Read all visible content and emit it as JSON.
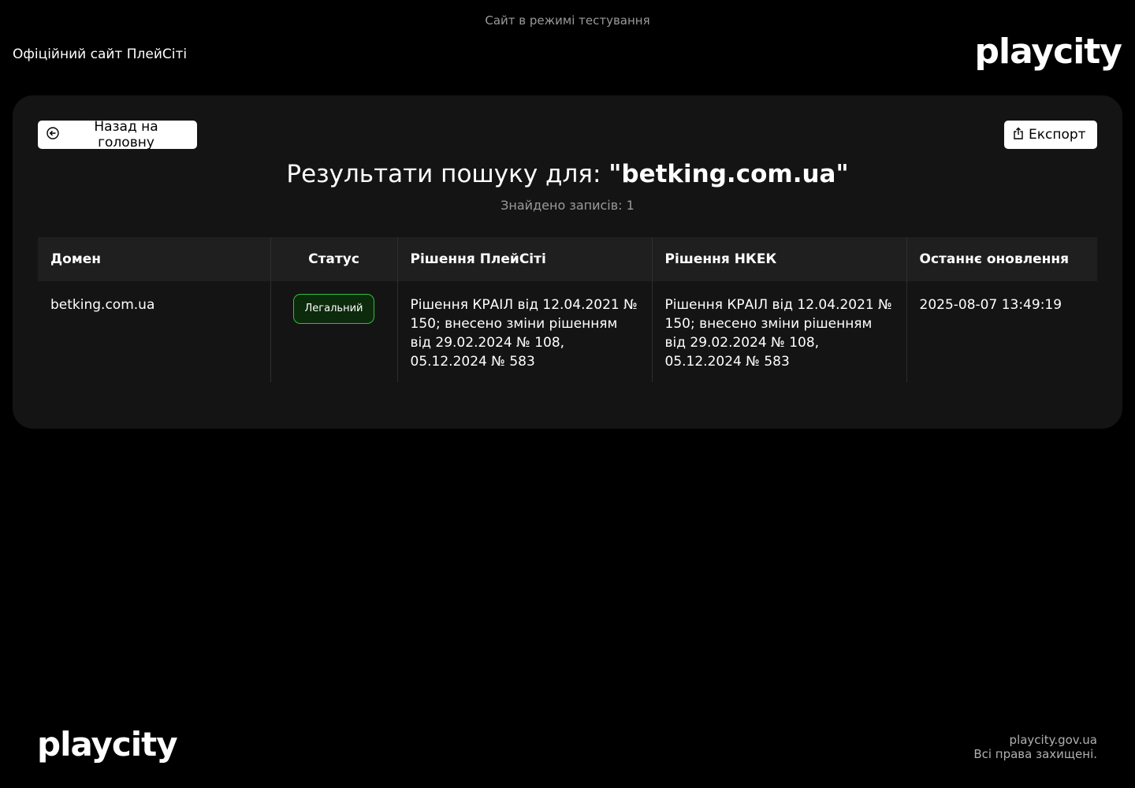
{
  "header": {
    "test_banner": "Сайт в режимі тестування",
    "site_label": "Офіційний сайт ПлейСіті",
    "logo_text": "playcity"
  },
  "toolbar": {
    "back_label": "Назад на головну",
    "back_icon": "arrow-left-circle-icon",
    "export_label": "Експорт",
    "export_icon": "share-export-icon"
  },
  "results": {
    "title_prefix": "Результати пошуку для: ",
    "query": "\"betking.com.ua\"",
    "count_text": "Знайдено записів: 1"
  },
  "table": {
    "headers": {
      "domain": "Домен",
      "status": "Статус",
      "playcity_decision": "Рішення ПлейСіті",
      "nkek_decision": "Рішення НКЕК",
      "last_update": "Останнє оновлення"
    },
    "rows": [
      {
        "domain": "betking.com.ua",
        "status": "Легальний",
        "playcity_decision": "Рішення КРАІЛ від 12.04.2021 № 150; внесено зміни рішенням від 29.02.2024 № 108, 05.12.2024 № 583",
        "nkek_decision": "Рішення КРАІЛ від 12.04.2021 № 150; внесено зміни рішенням від 29.02.2024 № 108, 05.12.2024 № 583",
        "last_update": "2025-08-07 13:49:19"
      }
    ]
  },
  "footer": {
    "logo_text": "playcity",
    "site_url": "playcity.gov.ua",
    "rights": "Всі права захищені."
  },
  "colors": {
    "background": "#000000",
    "panel": "#141414",
    "header_row": "#1f1f1f",
    "status_legal_border": "#2fbf3a",
    "status_legal_bg": "#0c2a0c"
  }
}
